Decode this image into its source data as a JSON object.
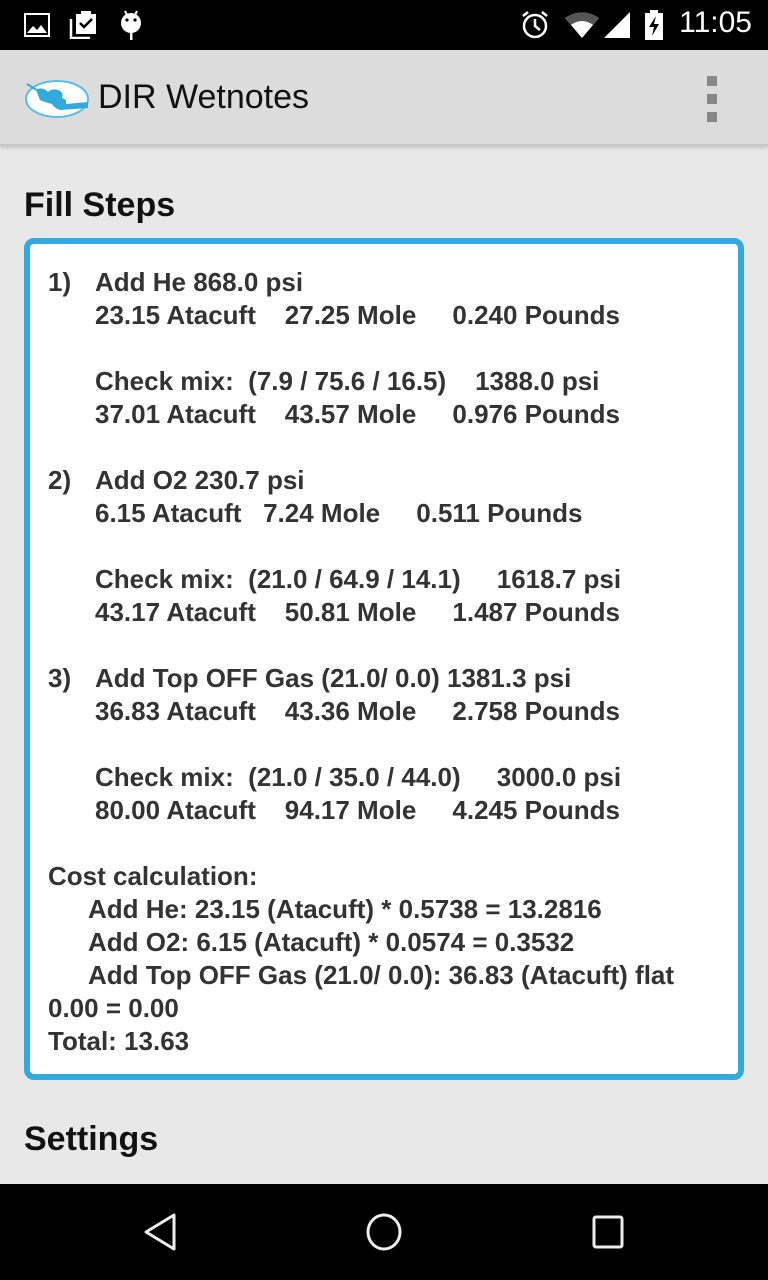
{
  "status_bar": {
    "left_icons": [
      "image-icon",
      "clipboard-check-icon",
      "android-debug-icon"
    ],
    "right_icons": [
      "alarm-icon",
      "wifi-icon",
      "cell-signal-icon",
      "battery-charging-icon"
    ],
    "time": "11:05"
  },
  "app_bar": {
    "title": "DIR Wetnotes",
    "logo_icon": "diver-logo-icon",
    "menu_icon": "overflow-menu-icon"
  },
  "fill_steps": {
    "heading": "Fill Steps",
    "steps": [
      {
        "number": "1)",
        "add_line": "Add He 868.0 psi",
        "add_stats": "23.15 Atacuft    27.25 Mole     0.240 Pounds",
        "check_line": "Check mix:  (7.9 / 75.6 / 16.5)    1388.0 psi",
        "check_stats": "37.01 Atacuft    43.57 Mole     0.976 Pounds"
      },
      {
        "number": "2)",
        "add_line": "Add O2 230.7 psi",
        "add_stats": "6.15 Atacuft   7.24 Mole     0.511 Pounds",
        "check_line": "Check mix:  (21.0 / 64.9 / 14.1)     1618.7 psi",
        "check_stats": "43.17 Atacuft    50.81 Mole     1.487 Pounds"
      },
      {
        "number": "3)",
        "add_line": "Add Top OFF Gas (21.0/ 0.0) 1381.3 psi",
        "add_stats": "36.83 Atacuft    43.36 Mole     2.758 Pounds",
        "check_line": "Check mix:  (21.0 / 35.0 / 44.0)     3000.0 psi",
        "check_stats": "80.00 Atacuft    94.17 Mole     4.245 Pounds"
      }
    ],
    "cost": {
      "heading": "Cost calculation:",
      "lines": [
        "Add He: 23.15 (Atacuft) * 0.5738 = 13.2816",
        "Add O2: 6.15 (Atacuft) * 0.0574 = 0.3532",
        "Add Top OFF Gas (21.0/ 0.0): 36.83 (Atacuft) flat"
      ],
      "continuation": "0.00 = 0.00",
      "total": "Total: 13.63"
    }
  },
  "settings": {
    "heading": "Settings"
  },
  "nav_bar": {
    "buttons": [
      "back-icon",
      "home-icon",
      "recents-icon"
    ]
  },
  "colors": {
    "accent": "#33aadd",
    "background": "#e8e8e8",
    "app_bar": "#dcdcdc"
  }
}
